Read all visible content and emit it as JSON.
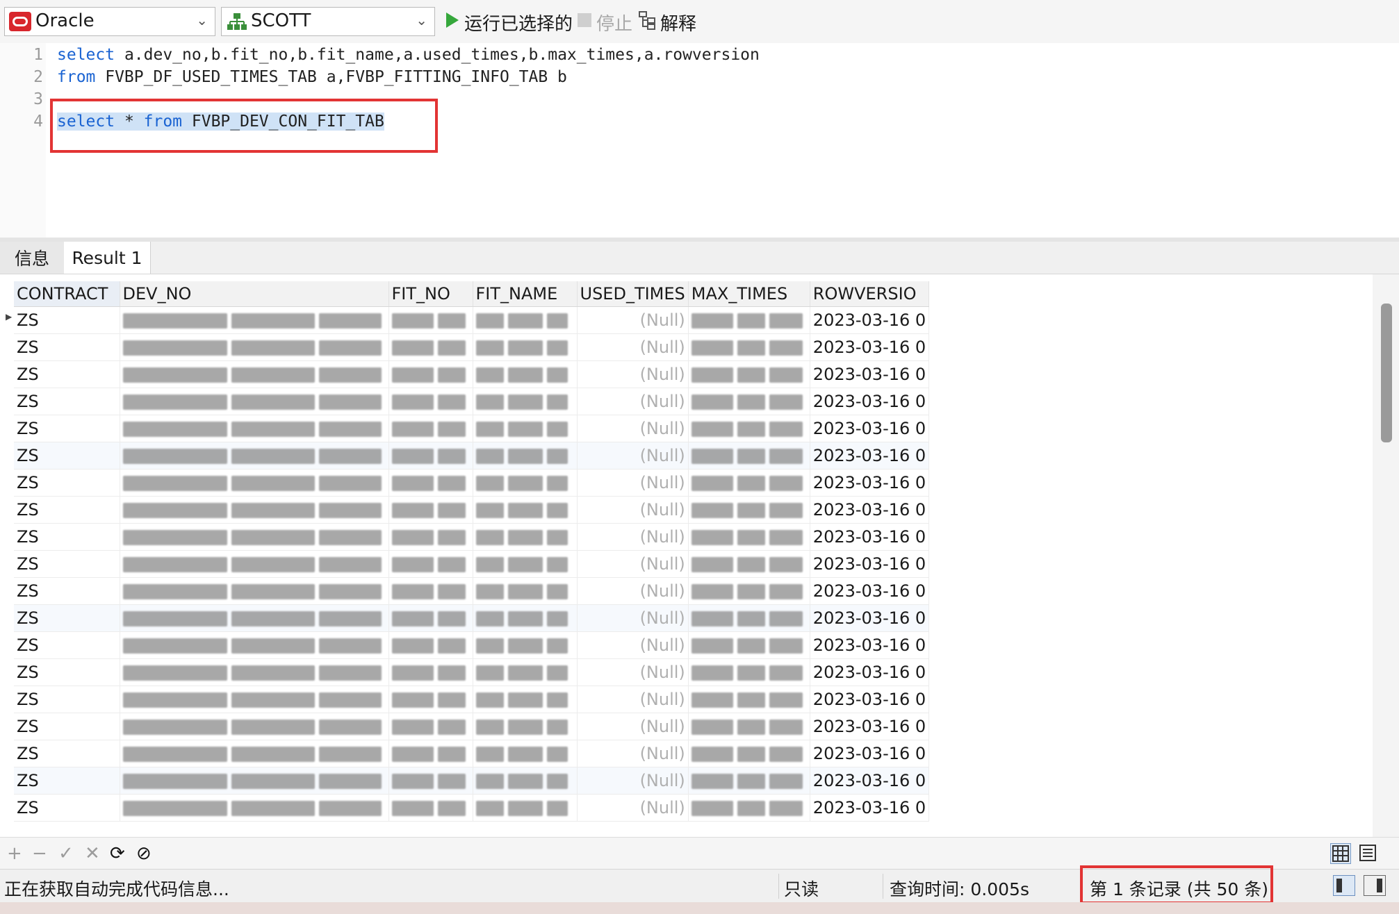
{
  "toolbar": {
    "connection": "Oracle",
    "schema": "SCOTT",
    "run_selected": "运行已选择的",
    "stop": "停止",
    "explain": "解释"
  },
  "editor": {
    "line_numbers": [
      "1",
      "2",
      "3",
      "4"
    ],
    "line1_kw": "select",
    "line1_rest": " a.dev_no,b.fit_no,b.fit_name,a.used_times,b.max_times,a.rowversion",
    "line2_kw": "from",
    "line2_rest": " FVBP_DF_USED_TIMES_TAB a,FVBP_FITTING_INFO_TAB b",
    "line4_kw1": "select",
    "line4_mid": " * ",
    "line4_kw2": "from",
    "line4_rest": " FVBP_DEV_CON_FIT_TAB"
  },
  "tabs": {
    "info": "信息",
    "result": "Result 1"
  },
  "grid": {
    "columns": [
      "CONTRACT",
      "DEV_NO",
      "FIT_NO",
      "FIT_NAME",
      "USED_TIMES",
      "MAX_TIMES",
      "ROWVERSIO"
    ],
    "rows": [
      {
        "contract": "ZS",
        "used": "(Null)",
        "rowversion": "2023-03-16 0"
      },
      {
        "contract": "ZS",
        "used": "(Null)",
        "rowversion": "2023-03-16 0"
      },
      {
        "contract": "ZS",
        "used": "(Null)",
        "rowversion": "2023-03-16 0"
      },
      {
        "contract": "ZS",
        "used": "(Null)",
        "rowversion": "2023-03-16 0"
      },
      {
        "contract": "ZS",
        "used": "(Null)",
        "rowversion": "2023-03-16 0"
      },
      {
        "contract": "ZS",
        "used": "(Null)",
        "rowversion": "2023-03-16 0"
      },
      {
        "contract": "ZS",
        "used": "(Null)",
        "rowversion": "2023-03-16 0"
      },
      {
        "contract": "ZS",
        "used": "(Null)",
        "rowversion": "2023-03-16 0"
      },
      {
        "contract": "ZS",
        "used": "(Null)",
        "rowversion": "2023-03-16 0"
      },
      {
        "contract": "ZS",
        "used": "(Null)",
        "rowversion": "2023-03-16 0"
      },
      {
        "contract": "ZS",
        "used": "(Null)",
        "rowversion": "2023-03-16 0"
      },
      {
        "contract": "ZS",
        "used": "(Null)",
        "rowversion": "2023-03-16 0"
      },
      {
        "contract": "ZS",
        "used": "(Null)",
        "rowversion": "2023-03-16 0"
      },
      {
        "contract": "ZS",
        "used": "(Null)",
        "rowversion": "2023-03-16 0"
      },
      {
        "contract": "ZS",
        "used": "(Null)",
        "rowversion": "2023-03-16 0"
      },
      {
        "contract": "ZS",
        "used": "(Null)",
        "rowversion": "2023-03-16 0"
      },
      {
        "contract": "ZS",
        "used": "(Null)",
        "rowversion": "2023-03-16 0"
      },
      {
        "contract": "ZS",
        "used": "(Null)",
        "rowversion": "2023-03-16 0"
      },
      {
        "contract": "ZS",
        "used": "(Null)",
        "rowversion": "2023-03-16 0"
      }
    ]
  },
  "status": {
    "message": "正在获取自动完成代码信息...",
    "mode": "只读",
    "query_time": "查询时间: 0.005s",
    "record": "第 1 条记录 (共 50 条)"
  }
}
